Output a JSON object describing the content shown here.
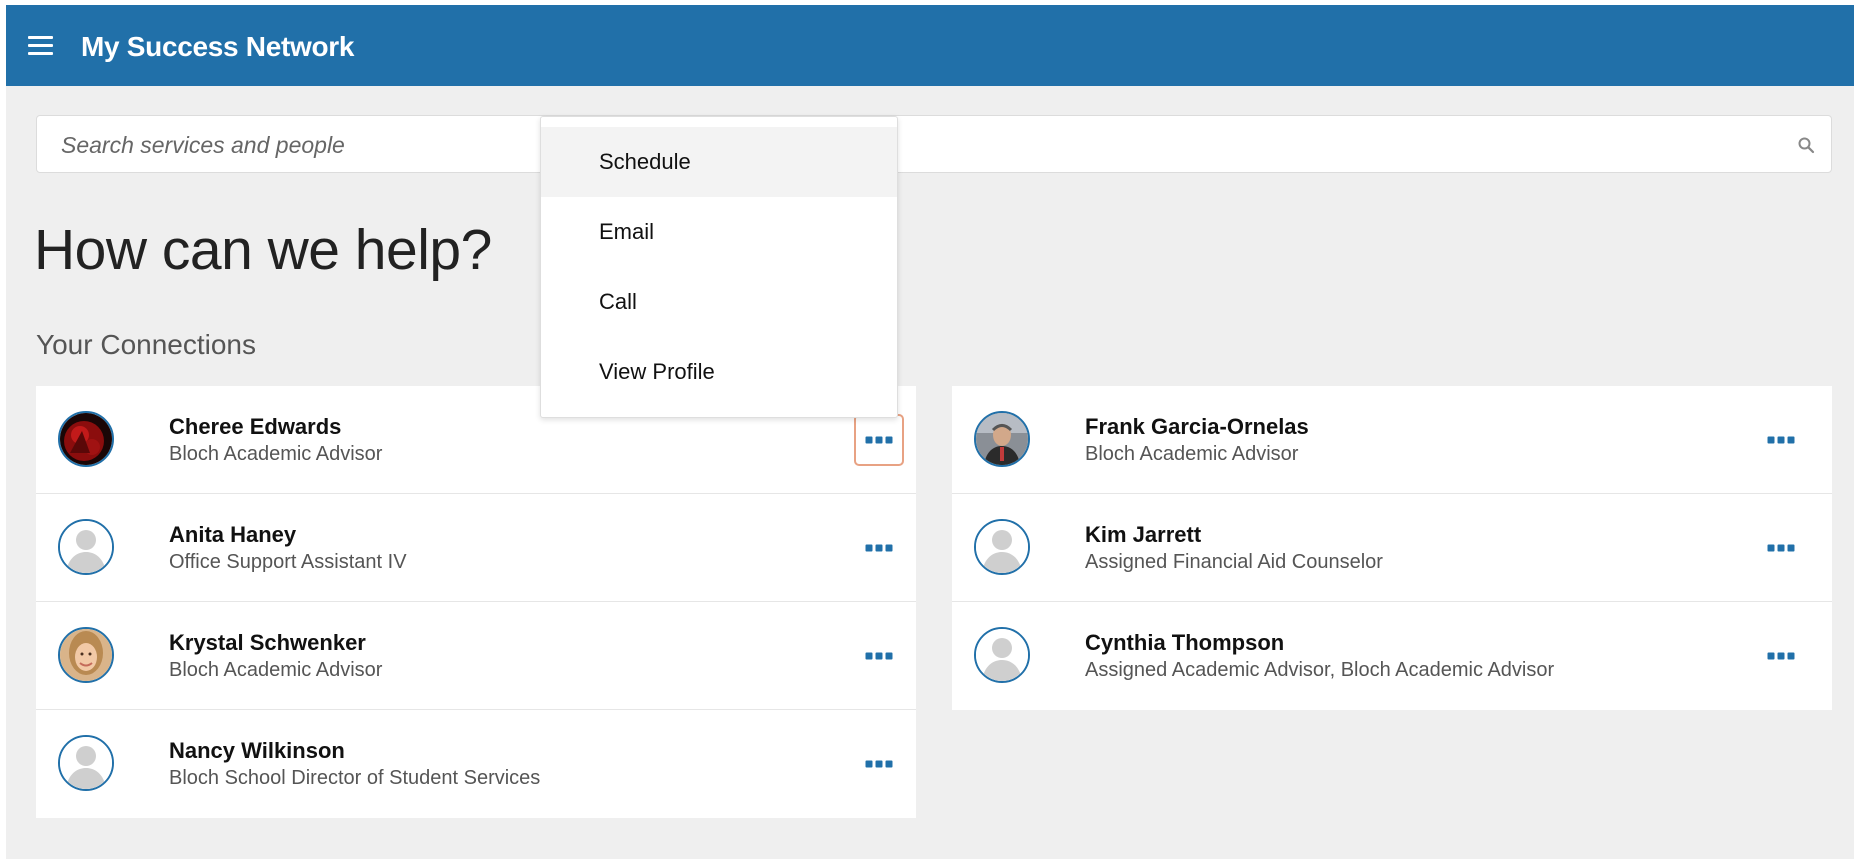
{
  "app": {
    "title": "My Success Network"
  },
  "search": {
    "placeholder": "Search services and people"
  },
  "page": {
    "headline": "How can we help?",
    "section_title": "Your Connections"
  },
  "connections": [
    {
      "name": "Cheree Edwards",
      "role": "Bloch Academic Advisor",
      "avatar": "photo"
    },
    {
      "name": "Anita Haney",
      "role": "Office Support Assistant IV",
      "avatar": "default-user"
    },
    {
      "name": "Krystal Schwenker",
      "role": "Bloch Academic Advisor",
      "avatar": "photo"
    },
    {
      "name": "Nancy Wilkinson",
      "role": "Bloch School Director of Student Services",
      "avatar": "default-user"
    },
    {
      "name": "Frank Garcia-Ornelas",
      "role": "Bloch Academic Advisor",
      "avatar": "photo"
    },
    {
      "name": "Kim Jarrett",
      "role": "Assigned Financial Aid Counselor",
      "avatar": "default-user"
    },
    {
      "name": "Cynthia Thompson",
      "role": "Assigned Academic Advisor, Bloch Academic Advisor",
      "avatar": "default-user"
    }
  ],
  "context_menu": {
    "items": [
      "Schedule",
      "Email",
      "Call",
      "View Profile"
    ],
    "highlighted": "Schedule"
  },
  "colors": {
    "brand": "#2170a9",
    "page_bg": "#efefef",
    "focus_ring": "#e8a283"
  },
  "icons": {
    "menu": "hamburger-icon",
    "search": "search-icon",
    "more": "more-horizontal-icon"
  }
}
